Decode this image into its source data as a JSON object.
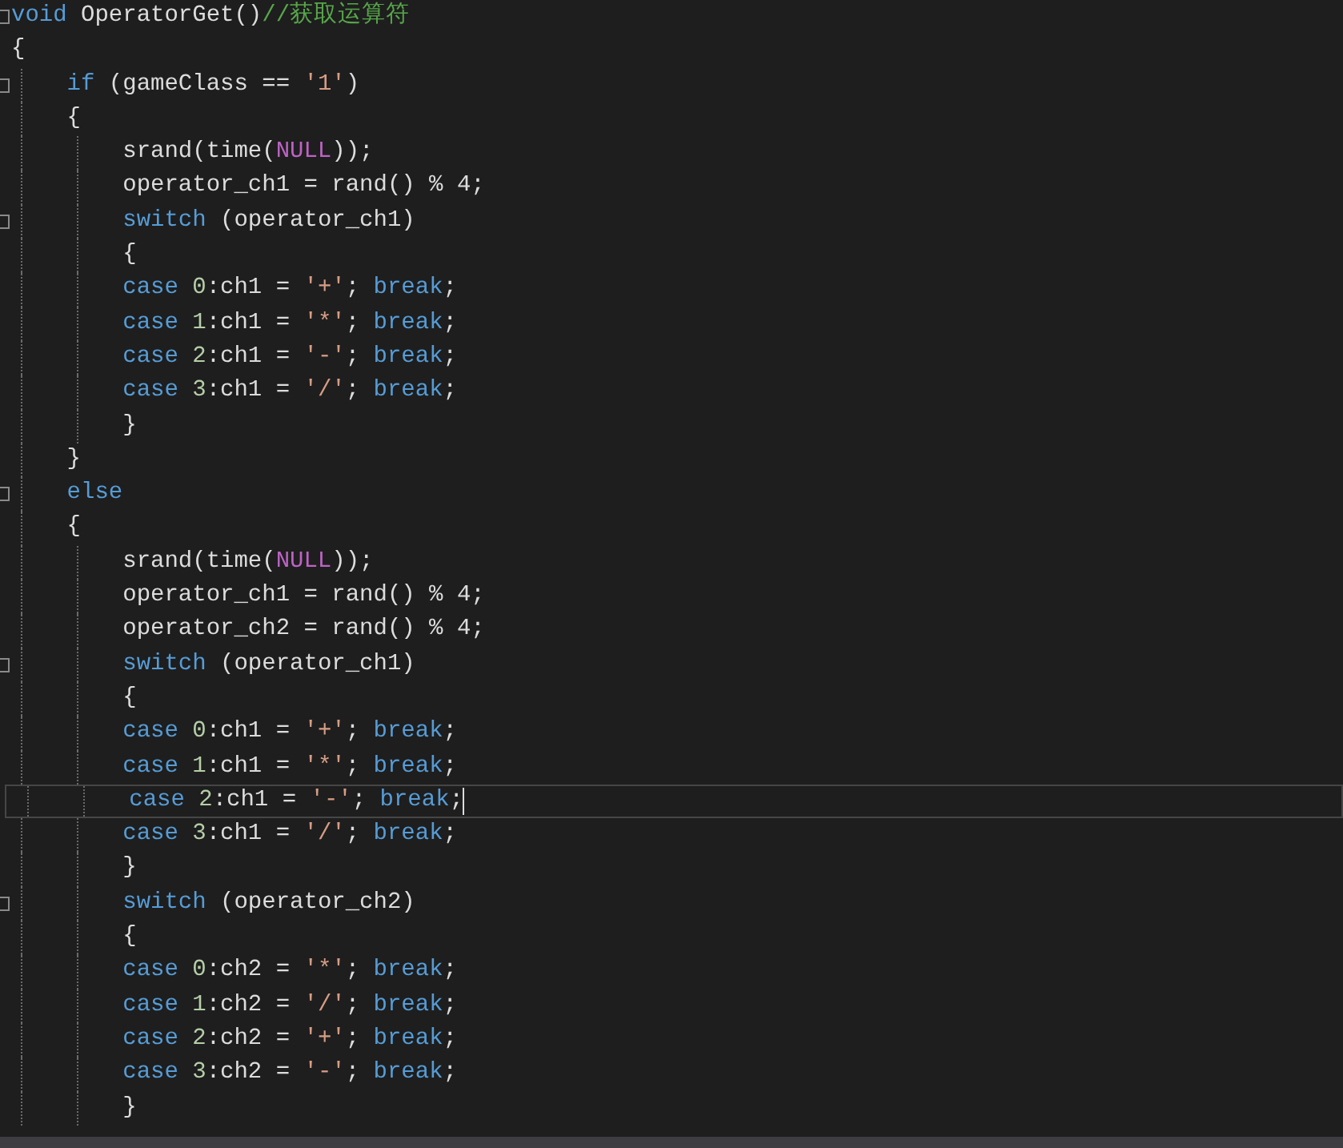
{
  "editor": {
    "lines": [
      {
        "fold_marker": true,
        "current": false,
        "tokens": [
          {
            "kind": "keyword",
            "text": "void"
          },
          {
            "kind": "plain",
            "text": " OperatorGet()"
          },
          {
            "kind": "comment",
            "text": "//获取运算符"
          }
        ]
      },
      {
        "fold_marker": false,
        "current": false,
        "tokens": [
          {
            "kind": "plain",
            "text": "{"
          }
        ]
      },
      {
        "fold_marker": true,
        "current": false,
        "tokens": [
          {
            "kind": "keyword",
            "text": "    if"
          },
          {
            "kind": "plain",
            "text": " (gameClass == "
          },
          {
            "kind": "string",
            "text": "'1'"
          },
          {
            "kind": "plain",
            "text": ")"
          }
        ]
      },
      {
        "fold_marker": false,
        "current": false,
        "tokens": [
          {
            "kind": "plain",
            "text": "    {"
          }
        ]
      },
      {
        "fold_marker": false,
        "current": false,
        "tokens": [
          {
            "kind": "plain",
            "text": "        srand(time("
          },
          {
            "kind": "macro",
            "text": "NULL"
          },
          {
            "kind": "plain",
            "text": "));"
          }
        ]
      },
      {
        "fold_marker": false,
        "current": false,
        "tokens": [
          {
            "kind": "plain",
            "text": "        operator_ch1 = rand() % 4;"
          }
        ]
      },
      {
        "fold_marker": true,
        "current": false,
        "tokens": [
          {
            "kind": "keyword",
            "text": "        switch"
          },
          {
            "kind": "plain",
            "text": " (operator_ch1)"
          }
        ]
      },
      {
        "fold_marker": false,
        "current": false,
        "tokens": [
          {
            "kind": "plain",
            "text": "        {"
          }
        ]
      },
      {
        "fold_marker": false,
        "current": false,
        "tokens": [
          {
            "kind": "keyword",
            "text": "        case"
          },
          {
            "kind": "number",
            "text": " 0"
          },
          {
            "kind": "plain",
            "text": ":ch1 = "
          },
          {
            "kind": "string",
            "text": "'+'"
          },
          {
            "kind": "plain",
            "text": "; "
          },
          {
            "kind": "keyword",
            "text": "break"
          },
          {
            "kind": "plain",
            "text": ";"
          }
        ]
      },
      {
        "fold_marker": false,
        "current": false,
        "tokens": [
          {
            "kind": "keyword",
            "text": "        case"
          },
          {
            "kind": "number",
            "text": " 1"
          },
          {
            "kind": "plain",
            "text": ":ch1 = "
          },
          {
            "kind": "string",
            "text": "'*'"
          },
          {
            "kind": "plain",
            "text": "; "
          },
          {
            "kind": "keyword",
            "text": "break"
          },
          {
            "kind": "plain",
            "text": ";"
          }
        ]
      },
      {
        "fold_marker": false,
        "current": false,
        "tokens": [
          {
            "kind": "keyword",
            "text": "        case"
          },
          {
            "kind": "number",
            "text": " 2"
          },
          {
            "kind": "plain",
            "text": ":ch1 = "
          },
          {
            "kind": "string",
            "text": "'-'"
          },
          {
            "kind": "plain",
            "text": "; "
          },
          {
            "kind": "keyword",
            "text": "break"
          },
          {
            "kind": "plain",
            "text": ";"
          }
        ]
      },
      {
        "fold_marker": false,
        "current": false,
        "tokens": [
          {
            "kind": "keyword",
            "text": "        case"
          },
          {
            "kind": "number",
            "text": " 3"
          },
          {
            "kind": "plain",
            "text": ":ch1 = "
          },
          {
            "kind": "string",
            "text": "'/'"
          },
          {
            "kind": "plain",
            "text": "; "
          },
          {
            "kind": "keyword",
            "text": "break"
          },
          {
            "kind": "plain",
            "text": ";"
          }
        ]
      },
      {
        "fold_marker": false,
        "current": false,
        "tokens": [
          {
            "kind": "plain",
            "text": "        }"
          }
        ]
      },
      {
        "fold_marker": false,
        "current": false,
        "tokens": [
          {
            "kind": "plain",
            "text": "    }"
          }
        ]
      },
      {
        "fold_marker": true,
        "current": false,
        "tokens": [
          {
            "kind": "keyword",
            "text": "    else"
          }
        ]
      },
      {
        "fold_marker": false,
        "current": false,
        "tokens": [
          {
            "kind": "plain",
            "text": "    {"
          }
        ]
      },
      {
        "fold_marker": false,
        "current": false,
        "tokens": [
          {
            "kind": "plain",
            "text": "        srand(time("
          },
          {
            "kind": "macro",
            "text": "NULL"
          },
          {
            "kind": "plain",
            "text": "));"
          }
        ]
      },
      {
        "fold_marker": false,
        "current": false,
        "tokens": [
          {
            "kind": "plain",
            "text": "        operator_ch1 = rand() % 4;"
          }
        ]
      },
      {
        "fold_marker": false,
        "current": false,
        "tokens": [
          {
            "kind": "plain",
            "text": "        operator_ch2 = rand() % 4;"
          }
        ]
      },
      {
        "fold_marker": true,
        "current": false,
        "tokens": [
          {
            "kind": "keyword",
            "text": "        switch"
          },
          {
            "kind": "plain",
            "text": " (operator_ch1)"
          }
        ]
      },
      {
        "fold_marker": false,
        "current": false,
        "tokens": [
          {
            "kind": "plain",
            "text": "        {"
          }
        ]
      },
      {
        "fold_marker": false,
        "current": false,
        "tokens": [
          {
            "kind": "keyword",
            "text": "        case"
          },
          {
            "kind": "number",
            "text": " 0"
          },
          {
            "kind": "plain",
            "text": ":ch1 = "
          },
          {
            "kind": "string",
            "text": "'+'"
          },
          {
            "kind": "plain",
            "text": "; "
          },
          {
            "kind": "keyword",
            "text": "break"
          },
          {
            "kind": "plain",
            "text": ";"
          }
        ]
      },
      {
        "fold_marker": false,
        "current": false,
        "tokens": [
          {
            "kind": "keyword",
            "text": "        case"
          },
          {
            "kind": "number",
            "text": " 1"
          },
          {
            "kind": "plain",
            "text": ":ch1 = "
          },
          {
            "kind": "string",
            "text": "'*'"
          },
          {
            "kind": "plain",
            "text": "; "
          },
          {
            "kind": "keyword",
            "text": "break"
          },
          {
            "kind": "plain",
            "text": ";"
          }
        ]
      },
      {
        "fold_marker": false,
        "current": true,
        "tokens": [
          {
            "kind": "keyword",
            "text": "        case"
          },
          {
            "kind": "number",
            "text": " 2"
          },
          {
            "kind": "plain",
            "text": ":ch1 = "
          },
          {
            "kind": "string",
            "text": "'-'"
          },
          {
            "kind": "plain",
            "text": "; "
          },
          {
            "kind": "keyword",
            "text": "break"
          },
          {
            "kind": "plain",
            "text": ";"
          }
        ]
      },
      {
        "fold_marker": false,
        "current": false,
        "tokens": [
          {
            "kind": "keyword",
            "text": "        case"
          },
          {
            "kind": "number",
            "text": " 3"
          },
          {
            "kind": "plain",
            "text": ":ch1 = "
          },
          {
            "kind": "string",
            "text": "'/'"
          },
          {
            "kind": "plain",
            "text": "; "
          },
          {
            "kind": "keyword",
            "text": "break"
          },
          {
            "kind": "plain",
            "text": ";"
          }
        ]
      },
      {
        "fold_marker": false,
        "current": false,
        "tokens": [
          {
            "kind": "plain",
            "text": "        }"
          }
        ]
      },
      {
        "fold_marker": true,
        "current": false,
        "tokens": [
          {
            "kind": "keyword",
            "text": "        switch"
          },
          {
            "kind": "plain",
            "text": " (operator_ch2)"
          }
        ]
      },
      {
        "fold_marker": false,
        "current": false,
        "tokens": [
          {
            "kind": "plain",
            "text": "        {"
          }
        ]
      },
      {
        "fold_marker": false,
        "current": false,
        "tokens": [
          {
            "kind": "keyword",
            "text": "        case"
          },
          {
            "kind": "number",
            "text": " 0"
          },
          {
            "kind": "plain",
            "text": ":ch2 = "
          },
          {
            "kind": "string",
            "text": "'*'"
          },
          {
            "kind": "plain",
            "text": "; "
          },
          {
            "kind": "keyword",
            "text": "break"
          },
          {
            "kind": "plain",
            "text": ";"
          }
        ]
      },
      {
        "fold_marker": false,
        "current": false,
        "tokens": [
          {
            "kind": "keyword",
            "text": "        case"
          },
          {
            "kind": "number",
            "text": " 1"
          },
          {
            "kind": "plain",
            "text": ":ch2 = "
          },
          {
            "kind": "string",
            "text": "'/'"
          },
          {
            "kind": "plain",
            "text": "; "
          },
          {
            "kind": "keyword",
            "text": "break"
          },
          {
            "kind": "plain",
            "text": ";"
          }
        ]
      },
      {
        "fold_marker": false,
        "current": false,
        "tokens": [
          {
            "kind": "keyword",
            "text": "        case"
          },
          {
            "kind": "number",
            "text": " 2"
          },
          {
            "kind": "plain",
            "text": ":ch2 = "
          },
          {
            "kind": "string",
            "text": "'+'"
          },
          {
            "kind": "plain",
            "text": "; "
          },
          {
            "kind": "keyword",
            "text": "break"
          },
          {
            "kind": "plain",
            "text": ";"
          }
        ]
      },
      {
        "fold_marker": false,
        "current": false,
        "tokens": [
          {
            "kind": "keyword",
            "text": "        case"
          },
          {
            "kind": "number",
            "text": " 3"
          },
          {
            "kind": "plain",
            "text": ":ch2 = "
          },
          {
            "kind": "string",
            "text": "'-'"
          },
          {
            "kind": "plain",
            "text": "; "
          },
          {
            "kind": "keyword",
            "text": "break"
          },
          {
            "kind": "plain",
            "text": ";"
          }
        ]
      },
      {
        "fold_marker": false,
        "current": false,
        "tokens": [
          {
            "kind": "plain",
            "text": "        }"
          }
        ]
      }
    ]
  }
}
